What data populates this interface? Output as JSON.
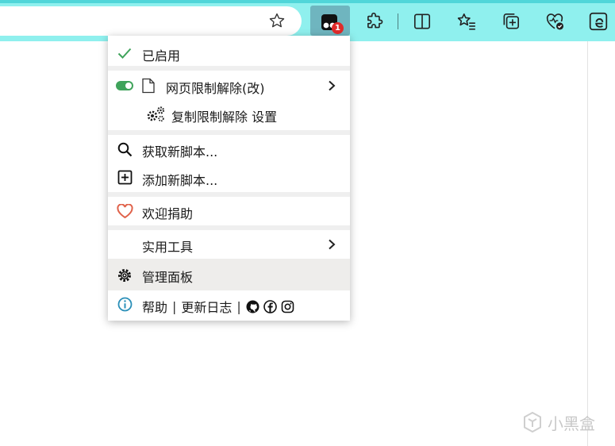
{
  "toolbar": {
    "extension_badge": "1",
    "icons": [
      "star-icon",
      "tampermonkey-icon",
      "puzzle-icon",
      "split-screen-icon",
      "favorites-icon",
      "collections-icon",
      "browser-health-icon",
      "edge-icon"
    ]
  },
  "menu": {
    "enabled": "已启用",
    "script_name": "网页限制解除(改)",
    "script_settings": "复制限制解除 设置",
    "get_new_scripts": "获取新脚本...",
    "add_new_script": "添加新脚本...",
    "donate": "欢迎捐助",
    "utilities": "实用工具",
    "dashboard": "管理面板",
    "help": "帮助",
    "separator": "|",
    "changelog": "更新日志"
  },
  "watermark": {
    "text": "小黑盒"
  },
  "colors": {
    "toolbar": "#8ff0ee",
    "toolbar_top": "#50d6d9",
    "active_extension": "#6fb5bf",
    "badge": "#e02b2b",
    "check": "#3fa35b",
    "heart": "#e0624a",
    "info": "#2a8fb8",
    "hover_row": "#eeedeb"
  }
}
